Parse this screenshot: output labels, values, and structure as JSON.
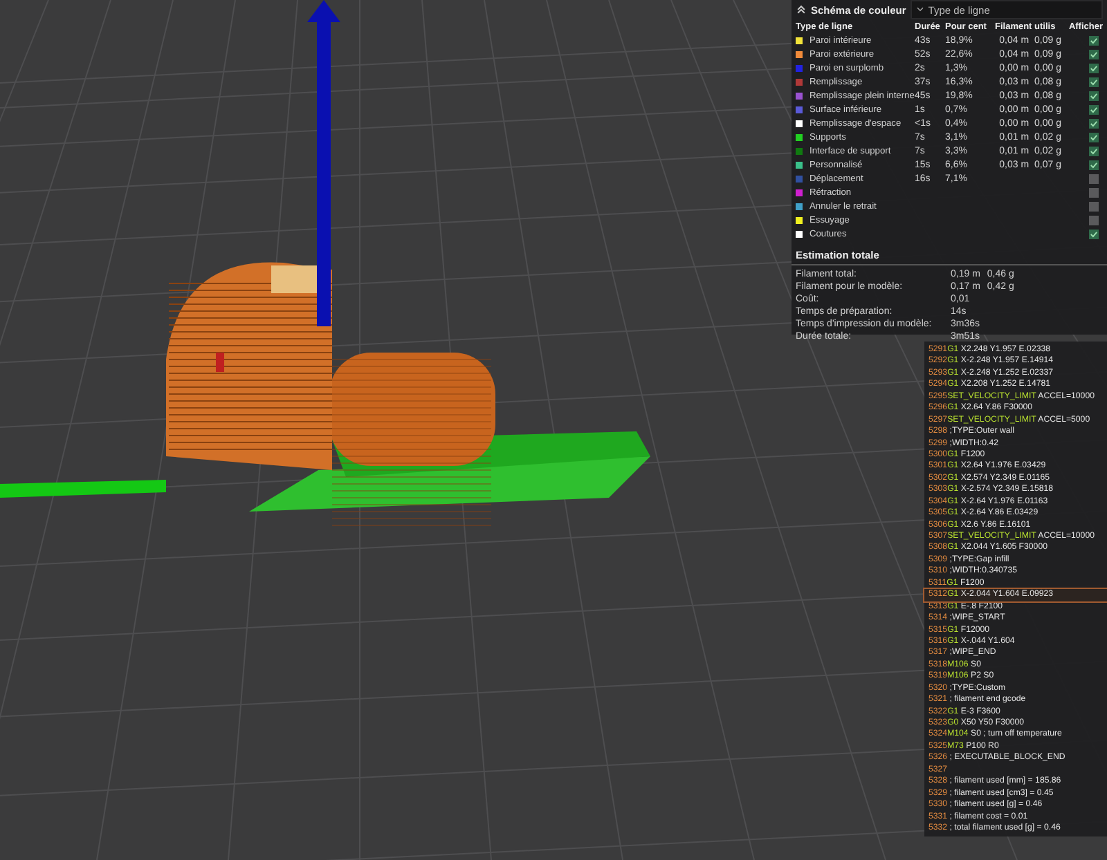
{
  "legend": {
    "title": "Schéma de couleur",
    "view_type": "Type de ligne",
    "columns": [
      "Type de ligne",
      "Durée",
      "Pour cent",
      "Filament utilis",
      "Afficher"
    ],
    "rows": [
      {
        "color": "#f2e33a",
        "label": "Paroi intérieure",
        "time": "43s",
        "percent": "18,9%",
        "meters": "0,04 m",
        "grams": "0,09 g",
        "checked": true
      },
      {
        "color": "#f08a3a",
        "label": "Paroi extérieure",
        "time": "52s",
        "percent": "22,6%",
        "meters": "0,04 m",
        "grams": "0,09 g",
        "checked": true
      },
      {
        "color": "#2222e0",
        "label": "Paroi en surplomb",
        "time": "2s",
        "percent": "1,3%",
        "meters": "0,00 m",
        "grams": "0,00 g",
        "checked": true
      },
      {
        "color": "#b03838",
        "label": "Remplissage",
        "time": "37s",
        "percent": "16,3%",
        "meters": "0,03 m",
        "grams": "0,08 g",
        "checked": true
      },
      {
        "color": "#9a52d0",
        "label": "Remplissage plein interne",
        "time": "45s",
        "percent": "19,8%",
        "meters": "0,03 m",
        "grams": "0,08 g",
        "checked": true
      },
      {
        "color": "#5a5ad8",
        "label": "Surface inférieure",
        "time": "1s",
        "percent": "0,7%",
        "meters": "0,00 m",
        "grams": "0,00 g",
        "checked": true
      },
      {
        "color": "#ffffff",
        "label": "Remplissage d'espace",
        "time": "<1s",
        "percent": "0,4%",
        "meters": "0,00 m",
        "grams": "0,00 g",
        "checked": true
      },
      {
        "color": "#22d022",
        "label": "Supports",
        "time": "7s",
        "percent": "3,1%",
        "meters": "0,01 m",
        "grams": "0,02 g",
        "checked": true
      },
      {
        "color": "#107a10",
        "label": "Interface de support",
        "time": "7s",
        "percent": "3,3%",
        "meters": "0,01 m",
        "grams": "0,02 g",
        "checked": true
      },
      {
        "color": "#3ac08a",
        "label": "Personnalisé",
        "time": "15s",
        "percent": "6,6%",
        "meters": "0,03 m",
        "grams": "0,07 g",
        "checked": true
      },
      {
        "color": "#3050a0",
        "label": "Déplacement",
        "time": "16s",
        "percent": "7,1%",
        "checked": false
      },
      {
        "color": "#d020d0",
        "label": "Rétraction",
        "checked": false
      },
      {
        "color": "#40a0c8",
        "label": "Annuler le retrait",
        "checked": false
      },
      {
        "color": "#f0f020",
        "label": "Essuyage",
        "checked": false
      },
      {
        "color": "#ffffff",
        "label": "Coutures",
        "checked": true
      }
    ],
    "estimate_title": "Estimation totale",
    "estimate": [
      {
        "label": "Filament total:",
        "values": [
          "0,19 m",
          "0,46 g"
        ]
      },
      {
        "label": "Filament pour le modèle:",
        "values": [
          "0,17 m",
          "0,42 g"
        ]
      },
      {
        "label": "Coût:",
        "values": [
          "0,01"
        ]
      },
      {
        "label": "Temps de préparation:",
        "values": [
          "14s"
        ]
      },
      {
        "label": "Temps d'impression du modèle:",
        "values": [
          "3m36s"
        ]
      },
      {
        "label": "Durée totale:",
        "values": [
          "3m51s"
        ]
      }
    ]
  },
  "gcode": [
    {
      "n": "5291",
      "cmd": "G1",
      "args": "X2.248 Y1.957 E.02338",
      "selected": false
    },
    {
      "n": "5292",
      "cmd": "G1",
      "args": "X-2.248 Y1.957 E.14914",
      "selected": false
    },
    {
      "n": "5293",
      "cmd": "G1",
      "args": "X-2.248 Y1.252 E.02337",
      "selected": false
    },
    {
      "n": "5294",
      "cmd": "G1",
      "args": "X2.208 Y1.252 E.14781",
      "selected": false
    },
    {
      "n": "5295",
      "cmd": "SET_VELOCITY_LIMIT",
      "args": "ACCEL=10000",
      "selected": false
    },
    {
      "n": "5296",
      "cmd": "G1",
      "args": "X2.64 Y.86 F30000",
      "selected": false
    },
    {
      "n": "5297",
      "cmd": "SET_VELOCITY_LIMIT",
      "args": "ACCEL=5000",
      "selected": false
    },
    {
      "n": "5298",
      "args": ";TYPE:Outer wall",
      "selected": false
    },
    {
      "n": "5299",
      "args": ";WIDTH:0.42",
      "selected": false
    },
    {
      "n": "5300",
      "cmd": "G1",
      "args": "F1200",
      "selected": false
    },
    {
      "n": "5301",
      "cmd": "G1",
      "args": "X2.64 Y1.976 E.03429",
      "selected": false
    },
    {
      "n": "5302",
      "cmd": "G1",
      "args": "X2.574 Y2.349 E.01165",
      "selected": false
    },
    {
      "n": "5303",
      "cmd": "G1",
      "args": "X-2.574 Y2.349 E.15818",
      "selected": false
    },
    {
      "n": "5304",
      "cmd": "G1",
      "args": "X-2.64 Y1.976 E.01163",
      "selected": false
    },
    {
      "n": "5305",
      "cmd": "G1",
      "args": "X-2.64 Y.86 E.03429",
      "selected": false
    },
    {
      "n": "5306",
      "cmd": "G1",
      "args": "X2.6 Y.86 E.16101",
      "selected": false
    },
    {
      "n": "5307",
      "cmd": "SET_VELOCITY_LIMIT",
      "args": "ACCEL=10000",
      "selected": false
    },
    {
      "n": "5308",
      "cmd": "G1",
      "args": "X2.044 Y1.605 F30000",
      "selected": false
    },
    {
      "n": "5309",
      "args": ";TYPE:Gap infill",
      "selected": false
    },
    {
      "n": "5310",
      "args": ";WIDTH:0.340735",
      "selected": false
    },
    {
      "n": "5311",
      "cmd": "G1",
      "args": "F1200",
      "selected": false
    },
    {
      "n": "5312",
      "cmd": "G1",
      "args": "X-2.044 Y1.604 E.09923",
      "selected": true
    },
    {
      "n": "5313",
      "cmd": "G1",
      "args": "E-.8 F2100",
      "selected": false
    },
    {
      "n": "5314",
      "args": ";WIPE_START",
      "selected": false
    },
    {
      "n": "5315",
      "cmd": "G1",
      "args": "F12000",
      "selected": false
    },
    {
      "n": "5316",
      "cmd": "G1",
      "args": "X-.044 Y1.604",
      "selected": false
    },
    {
      "n": "5317",
      "args": ";WIPE_END",
      "selected": false
    },
    {
      "n": "5318",
      "cmd": "M106",
      "args": "S0",
      "selected": false
    },
    {
      "n": "5319",
      "cmd": "M106",
      "args": "P2 S0",
      "selected": false
    },
    {
      "n": "5320",
      "args": ";TYPE:Custom",
      "selected": false
    },
    {
      "n": "5321",
      "args": "; filament end gcode",
      "selected": false
    },
    {
      "n": "5322",
      "cmd": "G1",
      "args": "E-3 F3600",
      "selected": false
    },
    {
      "n": "5323",
      "cmd": "G0",
      "args": "X50 Y50 F30000",
      "selected": false
    },
    {
      "n": "5324",
      "cmd": "M104",
      "args": "S0 ; turn off temperature",
      "selected": false
    },
    {
      "n": "5325",
      "cmd": "M73",
      "args": "P100 R0",
      "selected": false
    },
    {
      "n": "5326",
      "args": "; EXECUTABLE_BLOCK_END",
      "selected": false
    },
    {
      "n": "5327",
      "selected": false
    },
    {
      "n": "5328",
      "args": "; filament used [mm] = 185.86",
      "selected": false
    },
    {
      "n": "5329",
      "args": "; filament used [cm3] = 0.45",
      "selected": false
    },
    {
      "n": "5330",
      "args": "; filament used [g] = 0.46",
      "selected": false
    },
    {
      "n": "5331",
      "args": "; filament cost = 0.01",
      "selected": false
    },
    {
      "n": "5332",
      "args": "; total filament used [g] = 0.46",
      "selected": false
    }
  ]
}
